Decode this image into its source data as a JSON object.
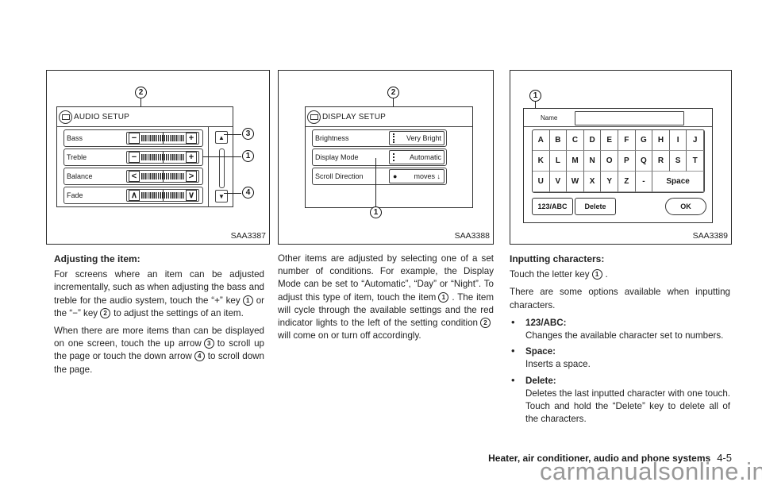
{
  "figures": {
    "audio": {
      "code": "SAA3387",
      "screen_title": "AUDIO SETUP",
      "rows": [
        {
          "label": "Bass",
          "left": "−",
          "right": "+"
        },
        {
          "label": "Treble",
          "left": "−",
          "right": "+"
        },
        {
          "label": "Balance",
          "left": "<",
          "right": ">"
        },
        {
          "label": "Fade",
          "left": "∧",
          "right": "∨"
        }
      ],
      "scroll_up": "▲",
      "scroll_down": "▼",
      "callouts": [
        "2",
        "3",
        "1",
        "4"
      ]
    },
    "display": {
      "code": "SAA3388",
      "screen_title": "DISPLAY SETUP",
      "rows": [
        {
          "label": "Brightness",
          "value": "Very Bright"
        },
        {
          "label": "Display Mode",
          "value": "Automatic"
        },
        {
          "label": "Scroll Direction",
          "value": "moves ✚"
        }
      ],
      "scroll_value_icon": "●",
      "scroll_value_text": "moves",
      "scroll_arrow": "↓",
      "callouts": [
        "2",
        "1"
      ]
    },
    "keyboard": {
      "code": "SAA3389",
      "name_label": "Name",
      "keys_row1": [
        "A",
        "B",
        "C",
        "D",
        "E",
        "F",
        "G",
        "H",
        "I",
        "J"
      ],
      "keys_row2": [
        "K",
        "L",
        "M",
        "N",
        "O",
        "P",
        "Q",
        "R",
        "S",
        "T"
      ],
      "keys_row3": [
        "U",
        "V",
        "W",
        "X",
        "Y",
        "Z",
        "-"
      ],
      "space_label": "Space",
      "mode_button": "123/ABC",
      "delete_button": "Delete",
      "ok_button": "OK",
      "callouts": [
        "1"
      ]
    }
  },
  "col1": {
    "heading": "Adjusting the item:",
    "p1_a": "For screens where an item can be adjusted incrementally, such as when adjusting the bass and treble for the audio system, touch the “+” key",
    "p1_c1": "1",
    "p1_b": "or the “−” key",
    "p1_c2": "2",
    "p1_c": "to adjust the settings of an item.",
    "p2_a": "When there are more items than can be displayed on one screen, touch the up arrow",
    "p2_c3": "3",
    "p2_b": "to scroll up the page or touch the down arrow",
    "p2_c4": "4",
    "p2_c": "to scroll down the page."
  },
  "col2": {
    "p1_a": "Other items are adjusted by selecting one of a set number of conditions. For example, the Display Mode can be set to “Automatic”, “Day” or “Night”. To adjust this type of item, touch the item",
    "p1_c1": "1",
    "p1_b": ". The item will cycle through the available settings and the red indicator lights to the left of the setting condition",
    "p1_c2": "2",
    "p1_c": "will come on or turn off accordingly."
  },
  "col3": {
    "heading": "Inputting characters:",
    "touch_a": "Touch the letter key",
    "touch_c1": "1",
    "touch_b": ".",
    "intro": "There are some options available when inputting characters.",
    "bullets": [
      {
        "title": "123/ABC:",
        "desc": "Changes the available character set to numbers."
      },
      {
        "title": "Space:",
        "desc": "Inserts a space."
      },
      {
        "title": "Delete:",
        "desc": "Deletes the last inputted character with one touch. Touch and hold the “Delete” key to delete all of the characters."
      }
    ]
  },
  "footer": {
    "section": "Heater, air conditioner, audio and phone systems",
    "page": "4-5"
  },
  "watermark": "carmanualsonline.info"
}
